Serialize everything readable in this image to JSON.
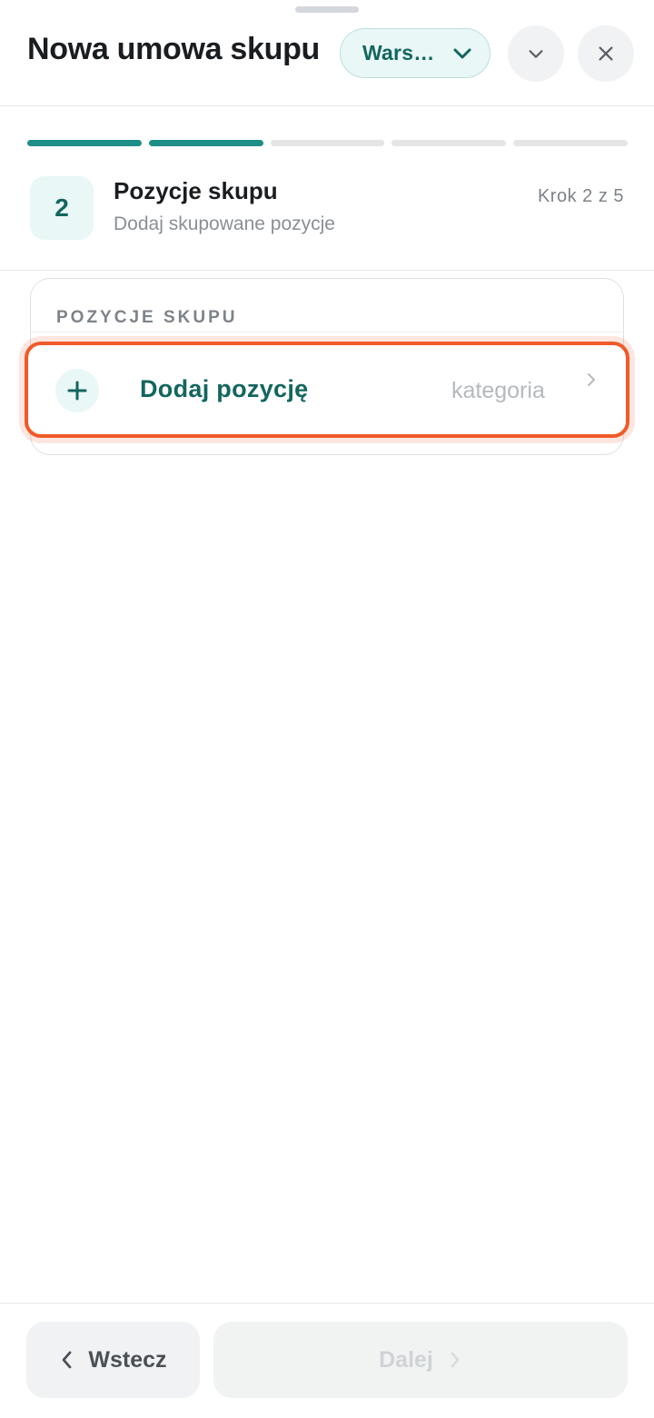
{
  "header": {
    "title": "Nowa umowa skupu",
    "branch_select_value": "Wars…"
  },
  "progress": {
    "total_steps": 5,
    "completed_steps": 2
  },
  "step": {
    "number": "2",
    "title": "Pozycje skupu",
    "subtitle": "Dodaj skupowane pozycje",
    "counter": "Krok 2 z 5"
  },
  "items_card": {
    "section_label": "POZYCJE SKUPU",
    "add_label": "Dodaj pozycję",
    "add_hint": "kategoria"
  },
  "footer": {
    "back_label": "Wstecz",
    "next_label": "Dalej"
  },
  "colors": {
    "accent": "#1e8f86",
    "accent_dark": "#13665f",
    "highlight": "#f05a28"
  },
  "icons": [
    "chevron-down-icon",
    "close-icon",
    "plus-icon",
    "chevron-right-icon",
    "chevron-left-icon"
  ]
}
